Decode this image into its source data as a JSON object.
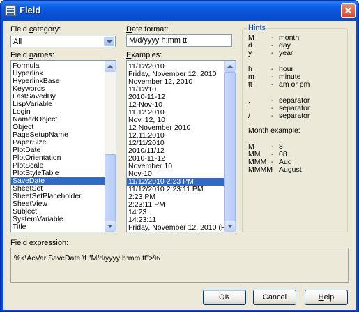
{
  "window": {
    "title": "Field"
  },
  "labels": {
    "field_category_prefix": "Field ",
    "field_category_ul": "c",
    "field_category_suffix": "ategory:",
    "field_names_prefix": "Field ",
    "field_names_ul": "n",
    "field_names_suffix": "ames:",
    "date_format_ul": "D",
    "date_format_suffix": "ate format:",
    "examples_ul": "E",
    "examples_suffix": "xamples:",
    "field_expression": "Field expression:"
  },
  "category": {
    "selected": "All"
  },
  "date_format": {
    "value": "M/d/yyyy h:mm tt"
  },
  "field_names": {
    "items": [
      "Formula",
      "Hyperlink",
      "HyperlinkBase",
      "Keywords",
      "LastSavedBy",
      "LispVariable",
      "Login",
      "NamedObject",
      "Object",
      "PageSetupName",
      "PaperSize",
      "PlotDate",
      "PlotOrientation",
      "PlotScale",
      "PlotStyleTable",
      "SaveDate",
      "SheetSet",
      "SheetSetPlaceholder",
      "SheetView",
      "Subject",
      "SystemVariable",
      "Title"
    ],
    "selected": "SaveDate"
  },
  "examples": {
    "items": [
      "11/12/2010",
      "Friday, November 12, 2010",
      "November 12, 2010",
      "11/12/10",
      "2010-11-12",
      "12-Nov-10",
      "11.12.2010",
      "Nov. 12, 10",
      "12 November 2010",
      "12.11.2010",
      "12/11/2010",
      "2010/11/12",
      "2010-11-12",
      "November 10",
      "Nov-10",
      "11/12/2010 2:23 PM",
      "11/12/2010 2:23:11 PM",
      "2:23 PM",
      "2:23:11 PM",
      "14:23",
      "14:23:11",
      "Friday, November 12, 2010 (Reg"
    ],
    "selected": "11/12/2010 2:23 PM"
  },
  "hints": {
    "title": "Hints",
    "time_rows": [
      {
        "k": "M",
        "d": "-",
        "m": "month"
      },
      {
        "k": "d",
        "d": "-",
        "m": "day"
      },
      {
        "k": "y",
        "d": "-",
        "m": "year"
      },
      {
        "k": "h",
        "d": "-",
        "m": "hour"
      },
      {
        "k": "m",
        "d": "-",
        "m": "minute"
      },
      {
        "k": "tt",
        "d": "-",
        "m": "am or pm"
      },
      {
        "k": ",",
        "d": "-",
        "m": "separator"
      },
      {
        "k": ".",
        "d": "-",
        "m": "separator"
      },
      {
        "k": "/",
        "d": "-",
        "m": "separator"
      }
    ],
    "month_title": "Month example:",
    "month_rows": [
      {
        "k": "M",
        "d": "-",
        "m": "8"
      },
      {
        "k": "MM",
        "d": "-",
        "m": "08"
      },
      {
        "k": "MMM",
        "d": "-",
        "m": "Aug"
      },
      {
        "k": "MMMM",
        "d": "-",
        "m": "August"
      }
    ]
  },
  "expression": {
    "text": "%<\\AcVar SaveDate \\f \"M/d/yyyy h:mm tt\">%"
  },
  "buttons": {
    "ok": "OK",
    "cancel": "Cancel",
    "help_ul": "H",
    "help_suffix": "elp"
  }
}
